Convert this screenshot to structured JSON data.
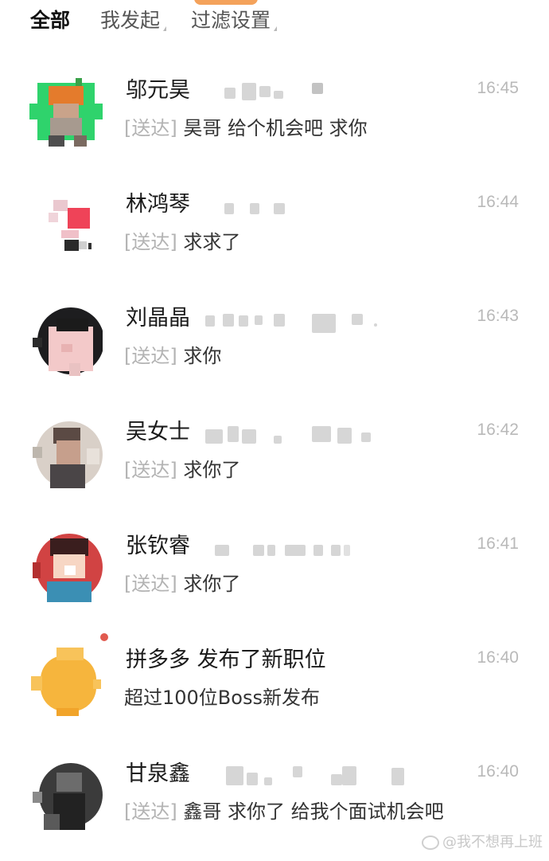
{
  "tabs": [
    {
      "label": "全部",
      "active": true
    },
    {
      "label": "我发起",
      "active": false
    },
    {
      "label": "过滤设置",
      "active": false
    }
  ],
  "conversations": [
    {
      "name": "邬元昊",
      "time": "16:45",
      "status": "[送达]",
      "message": " 昊哥 给个机会吧 求你"
    },
    {
      "name": "林鸿琴",
      "time": "16:44",
      "status": "[送达]",
      "message": " 求求了"
    },
    {
      "name": "刘晶晶",
      "time": "16:43",
      "status": "[送达]",
      "message": " 求你"
    },
    {
      "name": "吴女士",
      "time": "16:42",
      "status": "[送达]",
      "message": " 求你了"
    },
    {
      "name": "张钦睿",
      "time": "16:41",
      "status": "[送达]",
      "message": " 求你了"
    },
    {
      "name": "拼多多 发布了新职位",
      "time": "16:40",
      "status": "",
      "message": "超过100位Boss新发布"
    },
    {
      "name": "甘泉鑫",
      "time": "16:40",
      "status": "[送达]",
      "message": " 鑫哥 求你了 给我个面试机会吧"
    }
  ],
  "watermark": "@我不想再上班",
  "colors": {
    "unread_dot": "#e15a4f",
    "time": "#b9b9b9",
    "status": "#b3b3b3"
  }
}
